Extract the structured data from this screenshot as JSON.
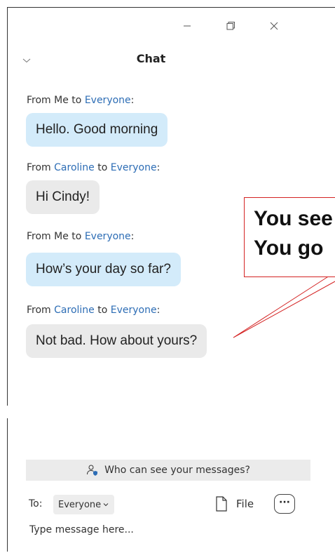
{
  "window": {
    "controls": {
      "minimize_icon": "minimize-icon",
      "restore_icon": "restore-icon",
      "close_icon": "close-icon"
    }
  },
  "header": {
    "title": "Chat",
    "collapse_icon": "chevron-down-icon"
  },
  "messages": [
    {
      "from_prefix": "From ",
      "sender": "Me",
      "to_word": " to ",
      "recipient": "Everyone",
      "suffix": ":",
      "text": "Hello. Good morning",
      "mine": true
    },
    {
      "from_prefix": "From ",
      "sender": "Caroline",
      "to_word": " to ",
      "recipient": "Everyone",
      "suffix": ":",
      "text": "Hi Cindy!",
      "mine": false
    },
    {
      "from_prefix": "From ",
      "sender": "Me",
      "to_word": " to ",
      "recipient": "Everyone",
      "suffix": ":",
      "text": "How’s your day so far?",
      "mine": true
    },
    {
      "from_prefix": "From ",
      "sender": "Caroline",
      "to_word": " to ",
      "recipient": "Everyone",
      "suffix": ":",
      "text": "Not bad. How about yours?",
      "mine": false
    }
  ],
  "callout": {
    "line1": "You see",
    "line2": "You go"
  },
  "visibility_banner": {
    "text": "Who can see your messages?",
    "icon": "person-shield-icon"
  },
  "composer": {
    "to_label": "To:",
    "recipient": "Everyone",
    "recipient_chevron": "chevron-down-icon",
    "file_label": "File",
    "file_icon": "file-icon",
    "more_label": "···",
    "placeholder": "Type message here..."
  },
  "colors": {
    "link_blue": "#2d6db5",
    "my_bubble": "#d3ebfa",
    "their_bubble": "#eaeaea",
    "callout_border": "#d42323"
  }
}
